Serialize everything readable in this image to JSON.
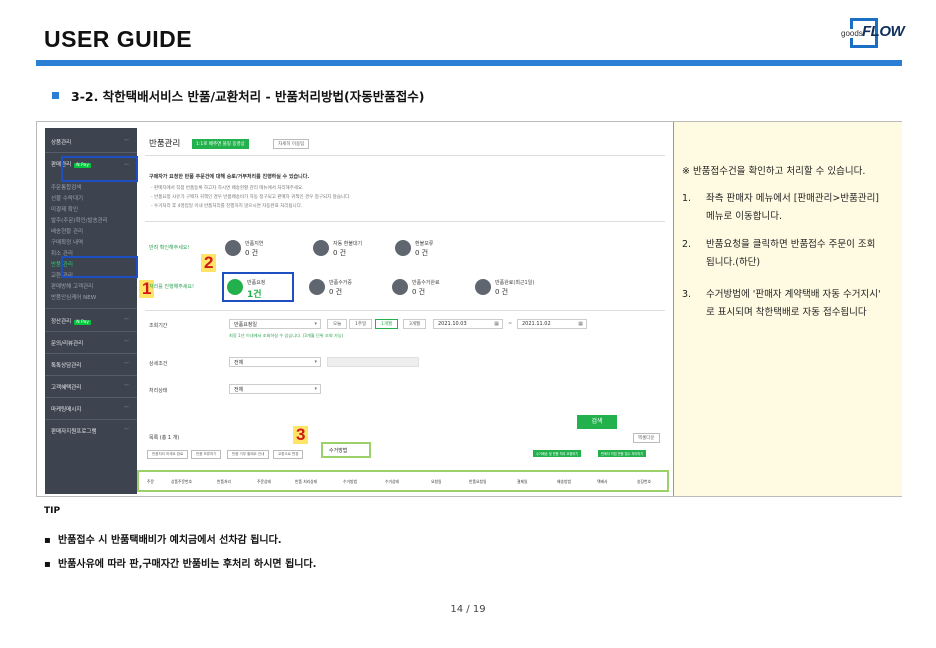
{
  "header": {
    "title": "USER GUIDE",
    "logo_small": "goods",
    "logo_big": "FLOW",
    "accent_color": "#2a7fd5"
  },
  "section_title": "3-2.   착한택배서비스 반품/교환처리 - 반품처리방법(자동반품접수)",
  "screenshot": {
    "sidebar": {
      "items": [
        {
          "label": "상품관리"
        },
        {
          "label": "판매관리",
          "badge": "N Pay"
        },
        {
          "label": "주문통합검색"
        },
        {
          "label": "선물 수락대기"
        },
        {
          "label": "미결제 확인"
        },
        {
          "label": "발주(주문)확인/발송관리"
        },
        {
          "label": "배송현황 관리"
        },
        {
          "label": "구매확정 내역"
        },
        {
          "label": "취소 관리"
        },
        {
          "label": "반품 관리"
        },
        {
          "label": "교환 관리"
        },
        {
          "label": "판매방해 고객관리"
        },
        {
          "label": "반품안심케어 NEW"
        },
        {
          "label": "정산관리",
          "badge": "N Pay"
        },
        {
          "label": "문의/리뷰관리"
        },
        {
          "label": "톡톡상담관리"
        },
        {
          "label": "고객혜택관리"
        },
        {
          "label": "마케팅메시지"
        },
        {
          "label": "판매자지원프로그램"
        }
      ]
    },
    "main": {
      "title": "반품관리",
      "btn_guide": "1:1로 배추면 블링 동영상",
      "btn_help": "자세히 이용팁",
      "info_head": "구매자가 요청한 반품 주문건에 대해 승로/거부처리를 진행하실 수 있습니다.",
      "info_lines": [
        "- 판매자에서 직접 반품등록 하고자 하시면 배송현황 관리 메뉴에서 처리해주세요.",
        "- 반품요청 사유가 구매자 귀책인 경우 반품배송비가 자동 청구되고 판매자 귀책인 경우 청구되지 않습니다.",
        "- 수거처리 후 4영업일 이내 반품처리를 진행하지 않으시면 자동완료 처리됩니다."
      ],
      "status_group1_label": "반려 확인해주세요!",
      "status_group2_label": "처리를 진행해주세요!",
      "statuses_row1": [
        {
          "label": "반품지연",
          "count": "0 건"
        },
        {
          "label": "자동 환불대기",
          "count": "0 건"
        },
        {
          "label": "환불보류",
          "count": "0 건"
        }
      ],
      "statuses_row2": [
        {
          "label": "반품요청",
          "count": "1건"
        },
        {
          "label": "반품수거중",
          "count": "0 건"
        },
        {
          "label": "반품수거완료",
          "count": "0 건"
        },
        {
          "label": "반품완료(최근1일)",
          "count": "0 건"
        }
      ],
      "filter": {
        "period_label": "조회기간",
        "period_type": "반품요청일",
        "period_buttons": [
          "오늘",
          "1주일",
          "1개월",
          "3개월"
        ],
        "period_selected": "1개월",
        "date_from": "2021.10.03",
        "date_sep": "~",
        "date_to": "2021.11.02",
        "period_hint": "최장 1년 이내에서 조회하실 수 있습니다. (3개월 단위 조회 가능)",
        "detail_label": "상세조건",
        "detail_value": "전체",
        "status_label": "처리상태",
        "status_value": "전체"
      },
      "search_button": "검색",
      "list_header": "목록 (총 1 개)",
      "excel_button": "엑셀다운",
      "list_buttons": [
        "반품처리 하세요 완료",
        "반품 보류하기",
        "반품 거부 할래요 안내",
        "교환으로 변경"
      ],
      "list_right_buttons": [
        "수거배송 및 반품 처리 요청하기",
        "판매자 직접 반품 접수 처리하기"
      ],
      "collect_method": "수거방법",
      "columns": [
        "주문",
        "상품주문번호",
        "반품처리",
        "주문상태",
        "반품 처리상태",
        "수거방법",
        "수거상태",
        "요청일",
        "반품요청일",
        "결제일",
        "배송방법",
        "택배사",
        "송장번호"
      ]
    },
    "markers": [
      "1",
      "2",
      "3"
    ]
  },
  "notes": {
    "head": "※ 반품접수건을 확인하고 처리할  수 있습니다.",
    "items": [
      {
        "num": "1.",
        "line1": "좌측 판매자 메뉴에서  [판매관리>반품관리]",
        "line2": "메뉴로 이동합니다."
      },
      {
        "num": "2.",
        "line1": "반품요청을 클릭하면  반품접수 주문이 조회",
        "line2": "됩니다.(하단)"
      },
      {
        "num": "3.",
        "line1": "수거방법에 '판매자 계약택배 자동 수거지시'",
        "line2": "로 표시되며 착한택배로 자동 접수됩니다"
      }
    ]
  },
  "tip": {
    "label": "TIP",
    "bullets": [
      "반품접수 시 반품택배비가 예치금에서 선차감 됩니다.",
      "반품사유에 따라 판,구매자간 반품비는 후처리 하시면 됩니다."
    ],
    "bullet_symbol": "▪"
  },
  "page_number": "14 / 19"
}
